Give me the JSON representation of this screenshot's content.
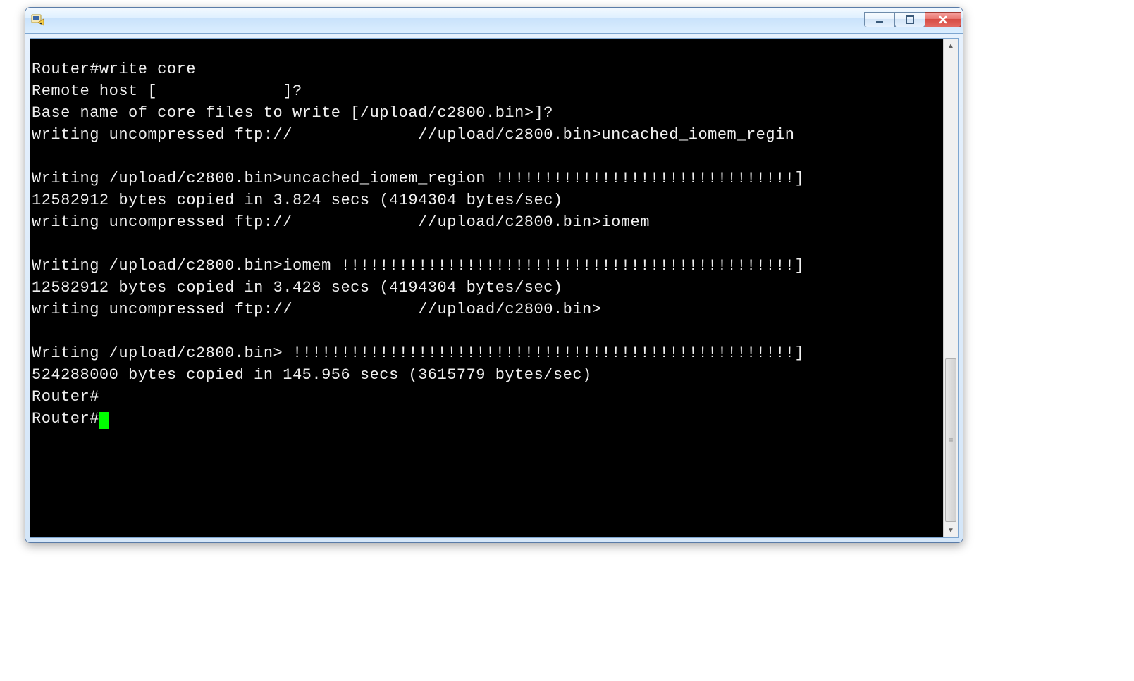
{
  "window": {
    "title": ""
  },
  "terminal": {
    "lines": [
      "Router#write core",
      "Remote host [             ]?",
      "Base name of core files to write [/upload/c2800.bin>]?",
      "writing uncompressed ftp://             //upload/c2800.bin>uncached_iomem_regin",
      "",
      "Writing /upload/c2800.bin>uncached_iomem_region !!!!!!!!!!!!!!!!!!!!!!!!!!!!!!!]",
      "12582912 bytes copied in 3.824 secs (4194304 bytes/sec)",
      "writing uncompressed ftp://             //upload/c2800.bin>iomem",
      "",
      "Writing /upload/c2800.bin>iomem !!!!!!!!!!!!!!!!!!!!!!!!!!!!!!!!!!!!!!!!!!!!!!!]",
      "12582912 bytes copied in 3.428 secs (4194304 bytes/sec)",
      "writing uncompressed ftp://             //upload/c2800.bin>",
      "",
      "Writing /upload/c2800.bin> !!!!!!!!!!!!!!!!!!!!!!!!!!!!!!!!!!!!!!!!!!!!!!!!!!!!]",
      "524288000 bytes copied in 145.956 secs (3615779 bytes/sec)",
      "Router#",
      "Router#"
    ],
    "prompt": "Router#"
  }
}
